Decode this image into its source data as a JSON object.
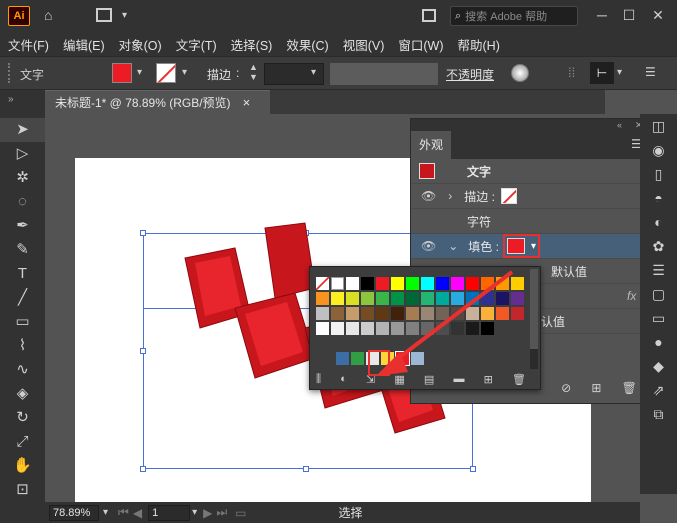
{
  "app": {
    "logo": "Ai"
  },
  "titlebar": {
    "search_placeholder": "搜索 Adobe 帮助",
    "icons": [
      "home-icon",
      "layout-icon",
      "window-icon",
      "search-icon"
    ]
  },
  "menu": [
    "文件(F)",
    "编辑(E)",
    "对象(O)",
    "文字(T)",
    "选择(S)",
    "效果(C)",
    "视图(V)",
    "窗口(W)",
    "帮助(H)"
  ],
  "controlbar": {
    "type_label": "文字",
    "stroke_label": "描边",
    "opacity_label": "不透明度",
    "fill_color": "#ed1c24"
  },
  "document": {
    "tab_title": "未标题-1* @ 78.89% (RGB/预览)",
    "close": "×"
  },
  "appearance_panel": {
    "title": "外观",
    "rows": [
      {
        "label": "文字",
        "type": "header"
      },
      {
        "label": "描边 :",
        "type": "stroke"
      },
      {
        "label": "字符",
        "type": "section"
      },
      {
        "label": "填色 :",
        "type": "fill",
        "color": "#ed1c24"
      },
      {
        "label": "默认值",
        "type": "opacity"
      },
      {
        "label": "fx",
        "type": "fx"
      },
      {
        "label": "认值",
        "type": "opacity"
      }
    ]
  },
  "swatches": {
    "selected": "#ed1c24",
    "grid": [
      [
        "none",
        "reg",
        "#ffffff",
        "#000000",
        "#ed1c24",
        "#ffff00",
        "#00ff00",
        "#00ffff",
        "#0000ff",
        "#ff00ff",
        "#ff0000",
        "#ff6600",
        "#ff9900",
        "#ffcc00",
        "#99cc00",
        "#00cc66"
      ],
      [
        "#f7931e",
        "#fcee21",
        "#d9e021",
        "#8cc63f",
        "#39b54a",
        "#009245",
        "#006837",
        "#22b573",
        "#00a99d",
        "#29abe2",
        "#0071bc",
        "#2e3192",
        "#1b1464",
        "#662d91",
        "#93278f",
        "#9e005d"
      ]
    ]
  },
  "status": {
    "zoom": "78.89%",
    "page": "1",
    "mode": "选择"
  }
}
